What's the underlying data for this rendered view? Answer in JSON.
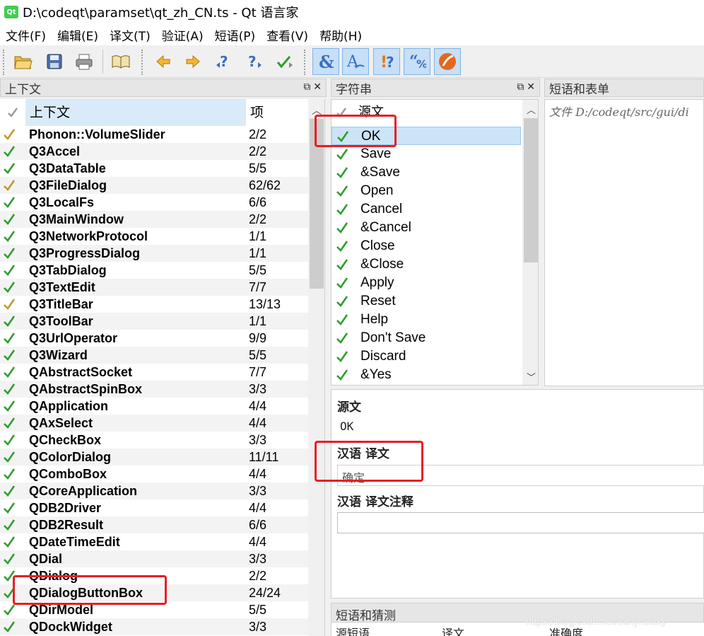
{
  "window": {
    "title": "D:\\codeqt\\paramset\\qt_zh_CN.ts - Qt 语言家",
    "logo_text": "Qt"
  },
  "menu": [
    "文件(F)",
    "编辑(E)",
    "译文(T)",
    "验证(A)",
    "短语(P)",
    "查看(V)",
    "帮助(H)"
  ],
  "toolbar": {
    "buttons": [
      {
        "name": "open-icon",
        "glyph": "📂"
      },
      {
        "name": "save-icon",
        "glyph": "💾"
      },
      {
        "name": "print-icon",
        "glyph": "🖨"
      },
      {
        "name": "phrasebook-icon",
        "glyph": "📖"
      },
      {
        "name": "prev-icon",
        "glyph": "⇦"
      },
      {
        "name": "next-icon",
        "glyph": "⇨"
      },
      {
        "name": "prev-unfinished-icon",
        "glyph": "?"
      },
      {
        "name": "next-unfinished-icon",
        "glyph": "?"
      },
      {
        "name": "done-next-icon",
        "glyph": "✔"
      },
      {
        "name": "accelerator-check-icon",
        "glyph": "&"
      },
      {
        "name": "punctuation-check-icon",
        "glyph": "A"
      },
      {
        "name": "phrase-check-icon",
        "glyph": "!"
      },
      {
        "name": "place-marker-check-icon",
        "glyph": "%"
      },
      {
        "name": "whats-this-icon",
        "glyph": "?"
      }
    ]
  },
  "context_panel": {
    "title": "上下文",
    "col_context": "上下文",
    "col_items": "项",
    "rows": [
      {
        "name": "Phonon::VolumeSlider",
        "count": "2/2",
        "status": "partial"
      },
      {
        "name": "Q3Accel",
        "count": "2/2",
        "status": "done"
      },
      {
        "name": "Q3DataTable",
        "count": "5/5",
        "status": "done"
      },
      {
        "name": "Q3FileDialog",
        "count": "62/62",
        "status": "partial"
      },
      {
        "name": "Q3LocalFs",
        "count": "6/6",
        "status": "done"
      },
      {
        "name": "Q3MainWindow",
        "count": "2/2",
        "status": "done"
      },
      {
        "name": "Q3NetworkProtocol",
        "count": "1/1",
        "status": "done"
      },
      {
        "name": "Q3ProgressDialog",
        "count": "1/1",
        "status": "done"
      },
      {
        "name": "Q3TabDialog",
        "count": "5/5",
        "status": "done"
      },
      {
        "name": "Q3TextEdit",
        "count": "7/7",
        "status": "done"
      },
      {
        "name": "Q3TitleBar",
        "count": "13/13",
        "status": "partial"
      },
      {
        "name": "Q3ToolBar",
        "count": "1/1",
        "status": "done"
      },
      {
        "name": "Q3UrlOperator",
        "count": "9/9",
        "status": "done"
      },
      {
        "name": "Q3Wizard",
        "count": "5/5",
        "status": "done"
      },
      {
        "name": "QAbstractSocket",
        "count": "7/7",
        "status": "done"
      },
      {
        "name": "QAbstractSpinBox",
        "count": "3/3",
        "status": "done"
      },
      {
        "name": "QApplication",
        "count": "4/4",
        "status": "done"
      },
      {
        "name": "QAxSelect",
        "count": "4/4",
        "status": "done"
      },
      {
        "name": "QCheckBox",
        "count": "3/3",
        "status": "done"
      },
      {
        "name": "QColorDialog",
        "count": "11/11",
        "status": "done"
      },
      {
        "name": "QComboBox",
        "count": "4/4",
        "status": "done"
      },
      {
        "name": "QCoreApplication",
        "count": "3/3",
        "status": "done"
      },
      {
        "name": "QDB2Driver",
        "count": "4/4",
        "status": "done"
      },
      {
        "name": "QDB2Result",
        "count": "6/6",
        "status": "done"
      },
      {
        "name": "QDateTimeEdit",
        "count": "4/4",
        "status": "done"
      },
      {
        "name": "QDial",
        "count": "3/3",
        "status": "done"
      },
      {
        "name": "QDialog",
        "count": "2/2",
        "status": "done"
      },
      {
        "name": "QDialogButtonBox",
        "count": "24/24",
        "status": "done"
      },
      {
        "name": "QDirModel",
        "count": "5/5",
        "status": "done"
      },
      {
        "name": "QDockWidget",
        "count": "3/3",
        "status": "done"
      }
    ]
  },
  "strings_panel": {
    "title": "字符串",
    "col_source": "源文",
    "rows": [
      "OK",
      "Save",
      "&Save",
      "Open",
      "Cancel",
      "&Cancel",
      "Close",
      "&Close",
      "Apply",
      "Reset",
      "Help",
      "Don't Save",
      "Discard",
      "&Yes"
    ],
    "selected_index": 0
  },
  "phrases_panel": {
    "title": "短语和表单",
    "path": "文件 D:/codeqt/src/gui/di"
  },
  "editor": {
    "source_label": "源文",
    "source_value": "OK",
    "translation_label": "汉语  译文",
    "translation_value": "确定",
    "comment_label": "汉语  译文注释",
    "comment_value": ""
  },
  "guesses_panel": {
    "title": "短语和猜测",
    "columns": [
      "源短语",
      "译文",
      "准确度"
    ]
  },
  "watermark": "https://blog.csdn.net/earlyneisky",
  "colors": {
    "highlight": "#e81e25",
    "check_done": "#2e9e2e",
    "check_partial": "#c8962a",
    "selection": "#cce4f7"
  }
}
